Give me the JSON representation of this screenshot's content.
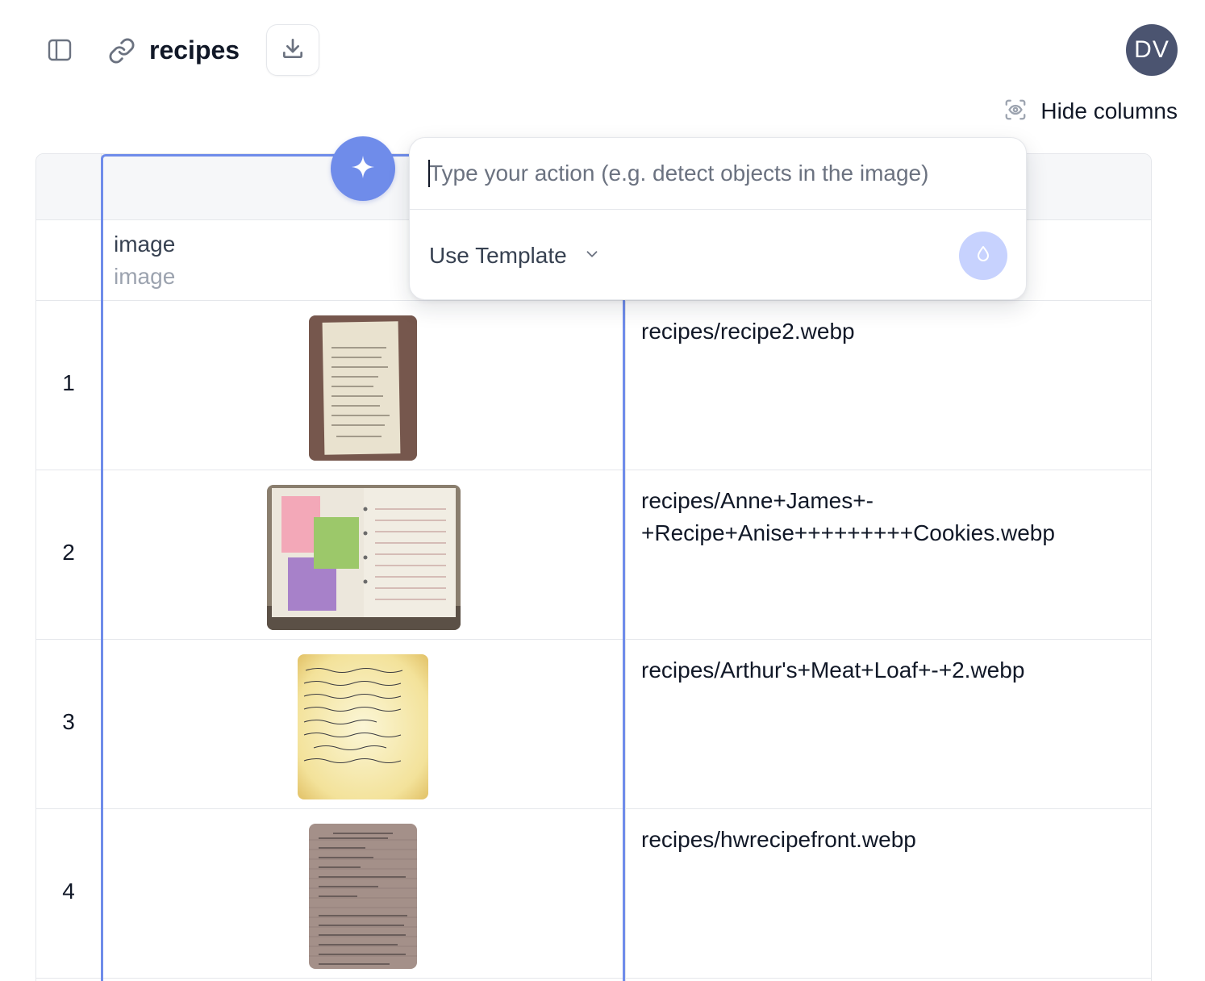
{
  "header": {
    "title": "recipes",
    "avatar_initials": "DV",
    "hide_columns_label": "Hide columns"
  },
  "table": {
    "columns": [
      {
        "name": "image",
        "type": "image"
      }
    ],
    "rows": [
      {
        "index": "1",
        "path": "recipes/recipe2.webp"
      },
      {
        "index": "2",
        "path": "recipes/Anne+James+-+Recipe+Anise+++++++++Cookies.webp"
      },
      {
        "index": "3",
        "path": "recipes/Arthur's+Meat+Loaf+-+2.webp"
      },
      {
        "index": "4",
        "path": "recipes/hwrecipefront.webp"
      }
    ]
  },
  "popover": {
    "placeholder": "Type your action (e.g. detect objects in the image)",
    "template_label": "Use Template"
  },
  "colors": {
    "accent": "#6f8cea",
    "submit_disabled": "#c7d2fe",
    "avatar_bg": "#4b5470"
  }
}
